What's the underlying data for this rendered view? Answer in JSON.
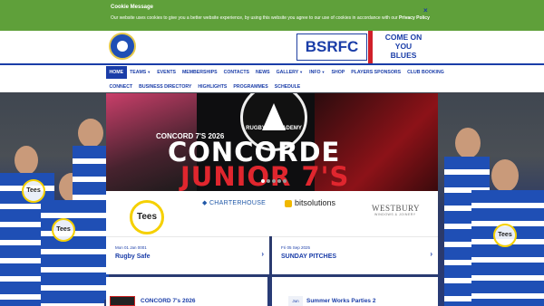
{
  "cookie": {
    "title": "Cookie Message",
    "text": "Our website uses cookies to give you a better website experience, by using this website you agree to our use of cookies in accordance with our",
    "link": "Privacy Policy",
    "close": "×"
  },
  "header": {
    "brand": "BSRFC",
    "slogan_line1": "COME ON",
    "slogan_line2": "YOU",
    "slogan_line3": "BLUES"
  },
  "nav": {
    "row1": [
      "HOME",
      "TEAMS",
      "EVENTS",
      "MEMBERSHIPS",
      "CONTACTS",
      "NEWS",
      "GALLERY",
      "INFO",
      "SHOP",
      "PLAYERS SPONSORS",
      "CLUB BOOKING"
    ],
    "row2": [
      "CONNECT",
      "BUSINESS DIRECTORY",
      "HIGHLIGHTS",
      "PROGRAMMES",
      "SCHEDULE"
    ]
  },
  "hero": {
    "crest_text": "RUGBY 7s ACADEMY",
    "subtitle": "CONCORD 7'S 2026",
    "title_line1": "CONCORDE",
    "title_line2": "JUNIOR 7'S"
  },
  "sponsors": {
    "tees": "Tees",
    "charterhouse": "CHARTERHOUSE",
    "bitsolutions": "bitsolutions",
    "westbury": "WESTBURY",
    "westbury_sub": "WINDOWS & JOINERY"
  },
  "news": [
    {
      "date": "Mon 01 Jan 0001",
      "title": "Rugby Safe",
      "arrow": "›"
    },
    {
      "date": "Fri 05 Sep 2025",
      "title": "SUNDAY PITCHES",
      "arrow": "›"
    }
  ],
  "panels": {
    "left_title": "CONCORD 7's 2026",
    "right_month": "Jun",
    "right_title": "Summer Works Parties 2"
  },
  "background": {
    "shirt_badge": "Tees"
  }
}
